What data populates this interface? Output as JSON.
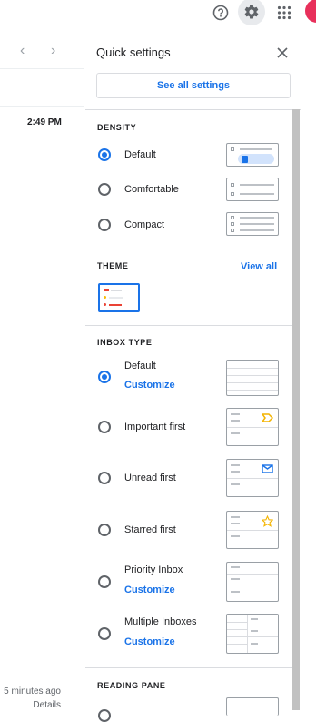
{
  "topbar": {
    "help_icon": "help-circle-icon",
    "settings_icon": "gear-icon",
    "apps_icon": "apps-grid-icon"
  },
  "list": {
    "time": "2:49 PM",
    "meta_time": "5 minutes ago",
    "details": "Details"
  },
  "quick_settings": {
    "title": "Quick settings",
    "see_all": "See all settings",
    "density": {
      "title": "DENSITY",
      "options": [
        {
          "label": "Default",
          "selected": true
        },
        {
          "label": "Comfortable",
          "selected": false
        },
        {
          "label": "Compact",
          "selected": false
        }
      ]
    },
    "theme": {
      "title": "THEME",
      "view_all": "View all"
    },
    "inbox_type": {
      "title": "INBOX TYPE",
      "options": [
        {
          "label": "Default",
          "customize": "Customize",
          "selected": true
        },
        {
          "label": "Important first",
          "selected": false
        },
        {
          "label": "Unread first",
          "selected": false
        },
        {
          "label": "Starred first",
          "selected": false
        },
        {
          "label": "Priority Inbox",
          "customize": "Customize",
          "selected": false
        },
        {
          "label": "Multiple Inboxes",
          "customize": "Customize",
          "selected": false
        }
      ]
    },
    "reading_pane": {
      "title": "READING PANE"
    }
  },
  "colors": {
    "accent": "#1a73e8",
    "avatar": "#e8305b",
    "important": "#f4b400",
    "star": "#f4b400"
  }
}
